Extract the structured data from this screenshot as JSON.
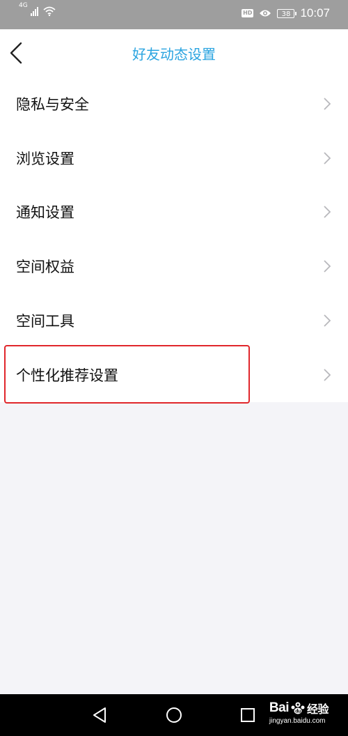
{
  "status_bar": {
    "network": "4G",
    "hd_badge": "HD",
    "battery_level": "38",
    "time": "10:07",
    "icons": [
      "signal-icon",
      "wifi-icon",
      "hd-icon",
      "eye-icon",
      "battery-icon"
    ]
  },
  "header": {
    "title": "好友动态设置",
    "back_icon": "chevron-left-icon"
  },
  "settings": {
    "items": [
      {
        "label": "隐私与安全"
      },
      {
        "label": "浏览设置"
      },
      {
        "label": "通知设置"
      },
      {
        "label": "空间权益"
      },
      {
        "label": "空间工具"
      },
      {
        "label": "个性化推荐设置",
        "highlighted": true
      }
    ],
    "chevron_icon": "chevron-right-icon"
  },
  "nav_bar": {
    "icons": [
      "back-triangle-icon",
      "home-circle-icon",
      "recents-square-icon"
    ]
  },
  "watermark": {
    "logo_text": "Bai",
    "logo_suffix": "经验",
    "url": "jingyan.baidu.com"
  },
  "colors": {
    "accent": "#2aa4e0",
    "highlight": "#e0262b",
    "status_bar_bg": "#9e9e9e",
    "page_bg": "#f4f4f8"
  }
}
